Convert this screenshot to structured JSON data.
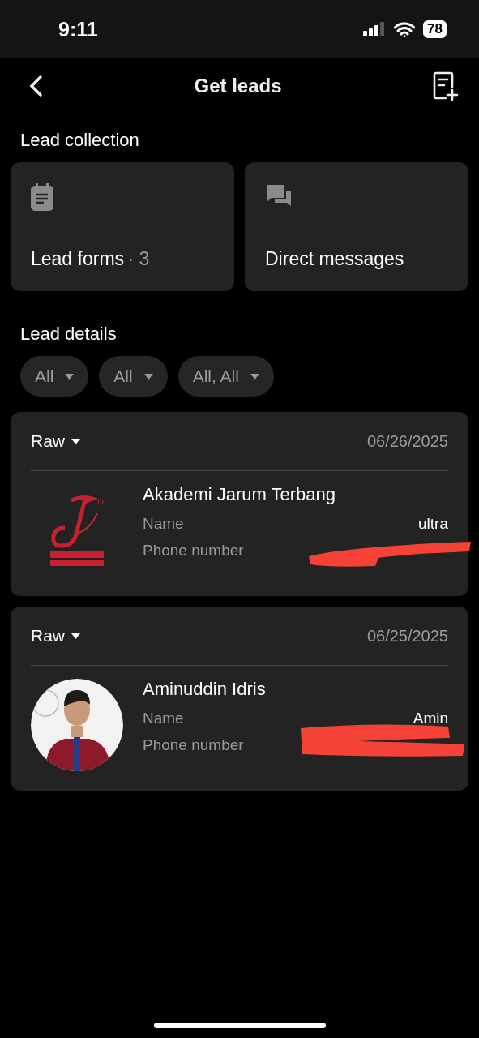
{
  "status_bar": {
    "time": "9:11",
    "battery": "78"
  },
  "header": {
    "title": "Get leads"
  },
  "lead_collection": {
    "title": "Lead collection",
    "cards": [
      {
        "kind": "form",
        "label": "Lead forms",
        "count": "· 3"
      },
      {
        "kind": "messages",
        "label": "Direct messages"
      }
    ]
  },
  "lead_details": {
    "title": "Lead details",
    "filters": [
      {
        "label": "All"
      },
      {
        "label": "All"
      },
      {
        "label": "All, All"
      }
    ],
    "leads": [
      {
        "status": "Raw",
        "date": "06/26/2025",
        "avatar": {
          "kind": "picture"
        },
        "title": "Akademi Jarum Terbang",
        "fields": [
          {
            "label": "Name",
            "value": "ultra"
          },
          {
            "label": "Phone number"
          }
        ],
        "redacted": true
      },
      {
        "status": "Raw",
        "date": "06/25/2025",
        "avatar": {
          "kind": "picture"
        },
        "title": "Aminuddin Idris",
        "fields": [
          {
            "label": "Name",
            "value": "Amin"
          },
          {
            "label": "Phone number"
          }
        ],
        "redacted": true
      }
    ]
  }
}
